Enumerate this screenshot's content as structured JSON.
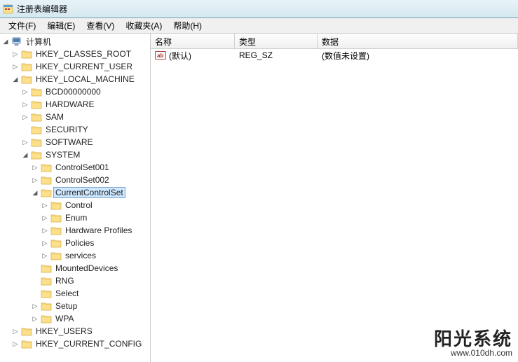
{
  "window": {
    "title": "注册表编辑器"
  },
  "menu": {
    "file": "文件(F)",
    "edit": "编辑(E)",
    "view": "查看(V)",
    "favorites": "收藏夹(A)",
    "help": "帮助(H)"
  },
  "columns": {
    "name": "名称",
    "type": "类型",
    "data": "数据"
  },
  "values": [
    {
      "name": "(默认)",
      "type": "REG_SZ",
      "data": "(数值未设置)"
    }
  ],
  "tree": {
    "root": "计算机",
    "hkcr": "HKEY_CLASSES_ROOT",
    "hkcu": "HKEY_CURRENT_USER",
    "hklm": "HKEY_LOCAL_MACHINE",
    "hklm_children": {
      "bcd": "BCD00000000",
      "hardware": "HARDWARE",
      "sam": "SAM",
      "security": "SECURITY",
      "software": "SOFTWARE",
      "system": "SYSTEM",
      "system_children": {
        "cs001": "ControlSet001",
        "cs002": "ControlSet002",
        "ccs": "CurrentControlSet",
        "ccs_children": {
          "control": "Control",
          "enum": "Enum",
          "hwprofiles": "Hardware Profiles",
          "policies": "Policies",
          "services": "services"
        },
        "mounted": "MountedDevices",
        "rng": "RNG",
        "select": "Select",
        "setup": "Setup",
        "wpa": "WPA"
      }
    },
    "hku": "HKEY_USERS",
    "hkcc": "HKEY_CURRENT_CONFIG"
  },
  "watermark": {
    "main": "阳光系统",
    "sub": "www.010dh.com"
  }
}
